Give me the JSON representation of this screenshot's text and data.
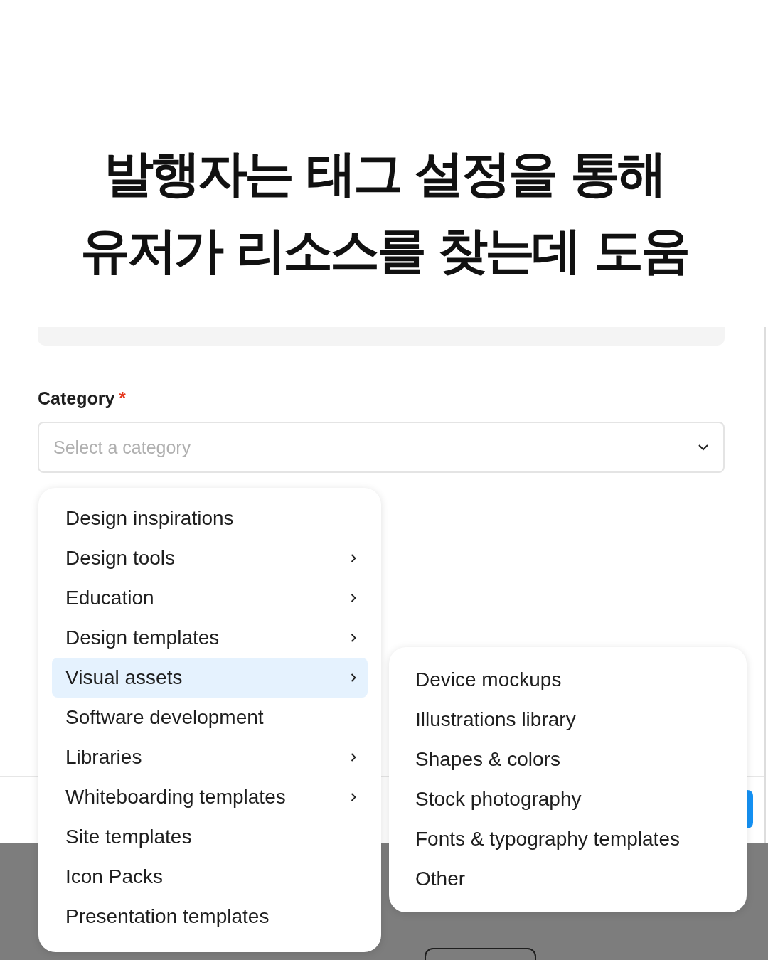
{
  "headline": [
    "발행자는 태그 설정을 통해",
    "유저가 리소스를 찾는데 도움"
  ],
  "field": {
    "label": "Category",
    "required_mark": "*",
    "placeholder": "Select a category"
  },
  "menu": [
    {
      "label": "Design inspirations",
      "has_submenu": false,
      "selected": false
    },
    {
      "label": "Design tools",
      "has_submenu": true,
      "selected": false
    },
    {
      "label": "Education",
      "has_submenu": true,
      "selected": false
    },
    {
      "label": "Design templates",
      "has_submenu": true,
      "selected": false
    },
    {
      "label": "Visual assets",
      "has_submenu": true,
      "selected": true
    },
    {
      "label": "Software development",
      "has_submenu": false,
      "selected": false
    },
    {
      "label": "Libraries",
      "has_submenu": true,
      "selected": false
    },
    {
      "label": "Whiteboarding templates",
      "has_submenu": true,
      "selected": false
    },
    {
      "label": "Site templates",
      "has_submenu": false,
      "selected": false
    },
    {
      "label": "Icon Packs",
      "has_submenu": false,
      "selected": false
    },
    {
      "label": "Presentation templates",
      "has_submenu": false,
      "selected": false
    }
  ],
  "submenu": [
    "Device mockups",
    "Illustrations library",
    "Shapes & colors",
    "Stock photography",
    "Fonts & typography templates",
    "Other"
  ]
}
